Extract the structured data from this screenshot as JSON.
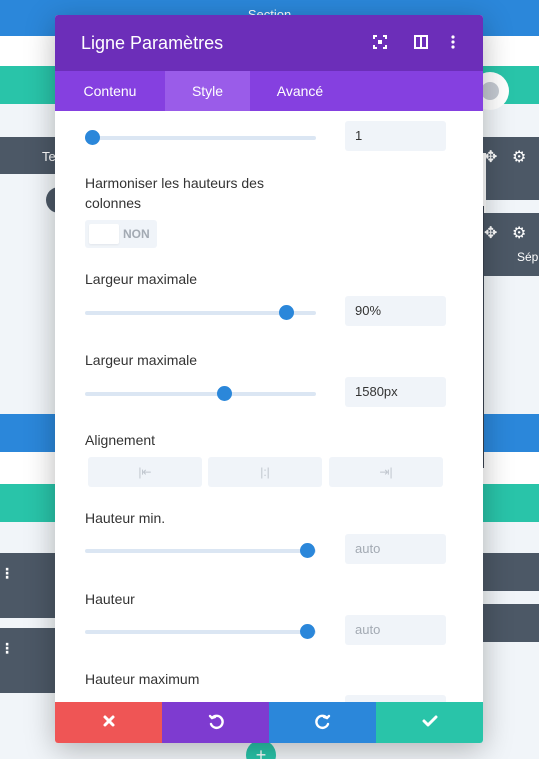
{
  "background": {
    "section_label": "Section",
    "left_module_text": "Te",
    "right_module_text": "Sép",
    "add_icon": "plus-icon"
  },
  "modal": {
    "title": "Ligne Paramètres",
    "header_icons": [
      "expand-icon",
      "columns-icon",
      "more-vertical-icon"
    ],
    "tabs": [
      {
        "label": "Contenu",
        "active": false
      },
      {
        "label": "Style",
        "active": true
      },
      {
        "label": "Avancé",
        "active": false
      }
    ],
    "fields": {
      "gutter": {
        "value": "1",
        "slider": 0.03
      },
      "equalize": {
        "label_line1": "Harmoniser les hauteurs des",
        "label_line2": "colonnes",
        "toggle_text": "NON"
      },
      "max_width": {
        "label": "Largeur maximale",
        "value": "90%",
        "slider": 0.87
      },
      "row_max_width": {
        "label": "Largeur maximale",
        "value": "1580px",
        "slider": 0.6
      },
      "alignment": {
        "label": "Alignement",
        "options": [
          "align-left-icon",
          "align-center-icon",
          "align-right-icon"
        ]
      },
      "min_height": {
        "label": "Hauteur min.",
        "placeholder": "auto",
        "slider": 0.96
      },
      "height": {
        "label": "Hauteur",
        "placeholder": "auto",
        "slider": 0.96
      },
      "max_height": {
        "label": "Hauteur maximum"
      }
    },
    "footer": {
      "buttons": [
        {
          "icon": "close-icon",
          "color": "#ef5555"
        },
        {
          "icon": "undo-icon",
          "color": "#7e3bd0"
        },
        {
          "icon": "redo-icon",
          "color": "#2b87da"
        },
        {
          "icon": "check-icon",
          "color": "#29c4a9"
        }
      ]
    }
  },
  "colors": {
    "header": "#6c2eb9",
    "tabs": "#8540e0",
    "accent": "#2b87da",
    "teal": "#29c4a9"
  }
}
